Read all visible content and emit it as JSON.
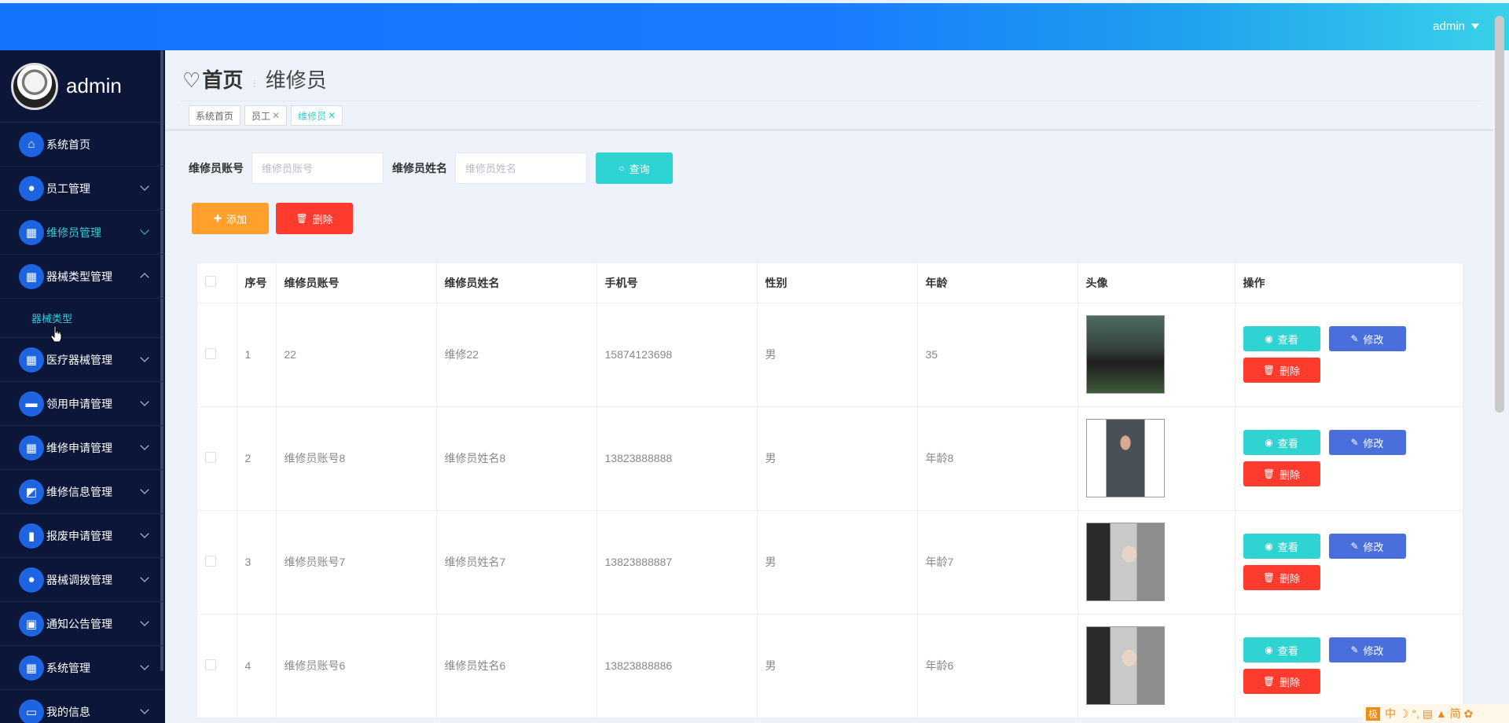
{
  "header": {
    "user": "admin"
  },
  "sidebar": {
    "brand_name": "admin",
    "items": [
      {
        "label": "系统首页",
        "icon": "home-icon",
        "glyph": "⌂",
        "has_chevron": false
      },
      {
        "label": "员工管理",
        "icon": "bulb-icon",
        "glyph": "●",
        "has_chevron": true
      },
      {
        "label": "维修员管理",
        "icon": "grid-icon",
        "glyph": "▦",
        "has_chevron": true,
        "active": true
      },
      {
        "label": "器械类型管理",
        "icon": "grid-icon",
        "glyph": "▦",
        "has_chevron": true,
        "expanded": true
      },
      {
        "label": "医疗器械管理",
        "icon": "grid-icon",
        "glyph": "▦",
        "has_chevron": true
      },
      {
        "label": "领用申请管理",
        "icon": "ticket-icon",
        "glyph": "▬",
        "has_chevron": true
      },
      {
        "label": "维修申请管理",
        "icon": "grid-icon",
        "glyph": "▦",
        "has_chevron": true
      },
      {
        "label": "维修信息管理",
        "icon": "chart-line-icon",
        "glyph": "◩",
        "has_chevron": true
      },
      {
        "label": "报废申请管理",
        "icon": "bar-chart-icon",
        "glyph": "▮",
        "has_chevron": true
      },
      {
        "label": "器械调拨管理",
        "icon": "user-icon",
        "glyph": "●",
        "has_chevron": true
      },
      {
        "label": "通知公告管理",
        "icon": "clipboard-icon",
        "glyph": "▣",
        "has_chevron": true
      },
      {
        "label": "系统管理",
        "icon": "grid-icon",
        "glyph": "▦",
        "has_chevron": true
      },
      {
        "label": "我的信息",
        "icon": "card-icon",
        "glyph": "▭",
        "has_chevron": true
      }
    ],
    "sub_item": "器械类型"
  },
  "breadcrumb": {
    "home": "首页",
    "current": "维修员"
  },
  "tags": [
    {
      "label": "系统首页",
      "closable": false
    },
    {
      "label": "员工",
      "closable": true
    },
    {
      "label": "维修员",
      "closable": true,
      "active": true
    }
  ],
  "search": {
    "account_label": "维修员账号",
    "account_placeholder": "维修员账号",
    "name_label": "维修员姓名",
    "name_placeholder": "维修员姓名",
    "query_button": "查询"
  },
  "actions": {
    "add": "添加",
    "delete": "删除"
  },
  "table": {
    "columns": [
      "序号",
      "维修员账号",
      "维修员姓名",
      "手机号",
      "性别",
      "年龄",
      "头像",
      "操作"
    ],
    "rows": [
      {
        "no": "1",
        "account": "22",
        "name": "维修22",
        "phone": "15874123698",
        "gender": "男",
        "age": "35"
      },
      {
        "no": "2",
        "account": "维修员账号8",
        "name": "维修员姓名8",
        "phone": "13823888888",
        "gender": "男",
        "age": "年龄8"
      },
      {
        "no": "3",
        "account": "维修员账号7",
        "name": "维修员姓名7",
        "phone": "13823888887",
        "gender": "男",
        "age": "年龄7"
      },
      {
        "no": "4",
        "account": "维修员账号6",
        "name": "维修员姓名6",
        "phone": "13823888886",
        "gender": "男",
        "age": "年龄6"
      }
    ],
    "row_actions": {
      "view": "查看",
      "edit": "修改",
      "delete": "删除"
    }
  },
  "ime": {
    "box": "极",
    "chars": "中 ☽ °, ▤ ▲ 简 ✿"
  },
  "colors": {
    "accent": "#2ed3d2",
    "primary": "#1473ff",
    "warning": "#ff9f2c",
    "danger": "#ff3b2e",
    "edit": "#4a6fdc",
    "sidebar": "#0b1638"
  }
}
